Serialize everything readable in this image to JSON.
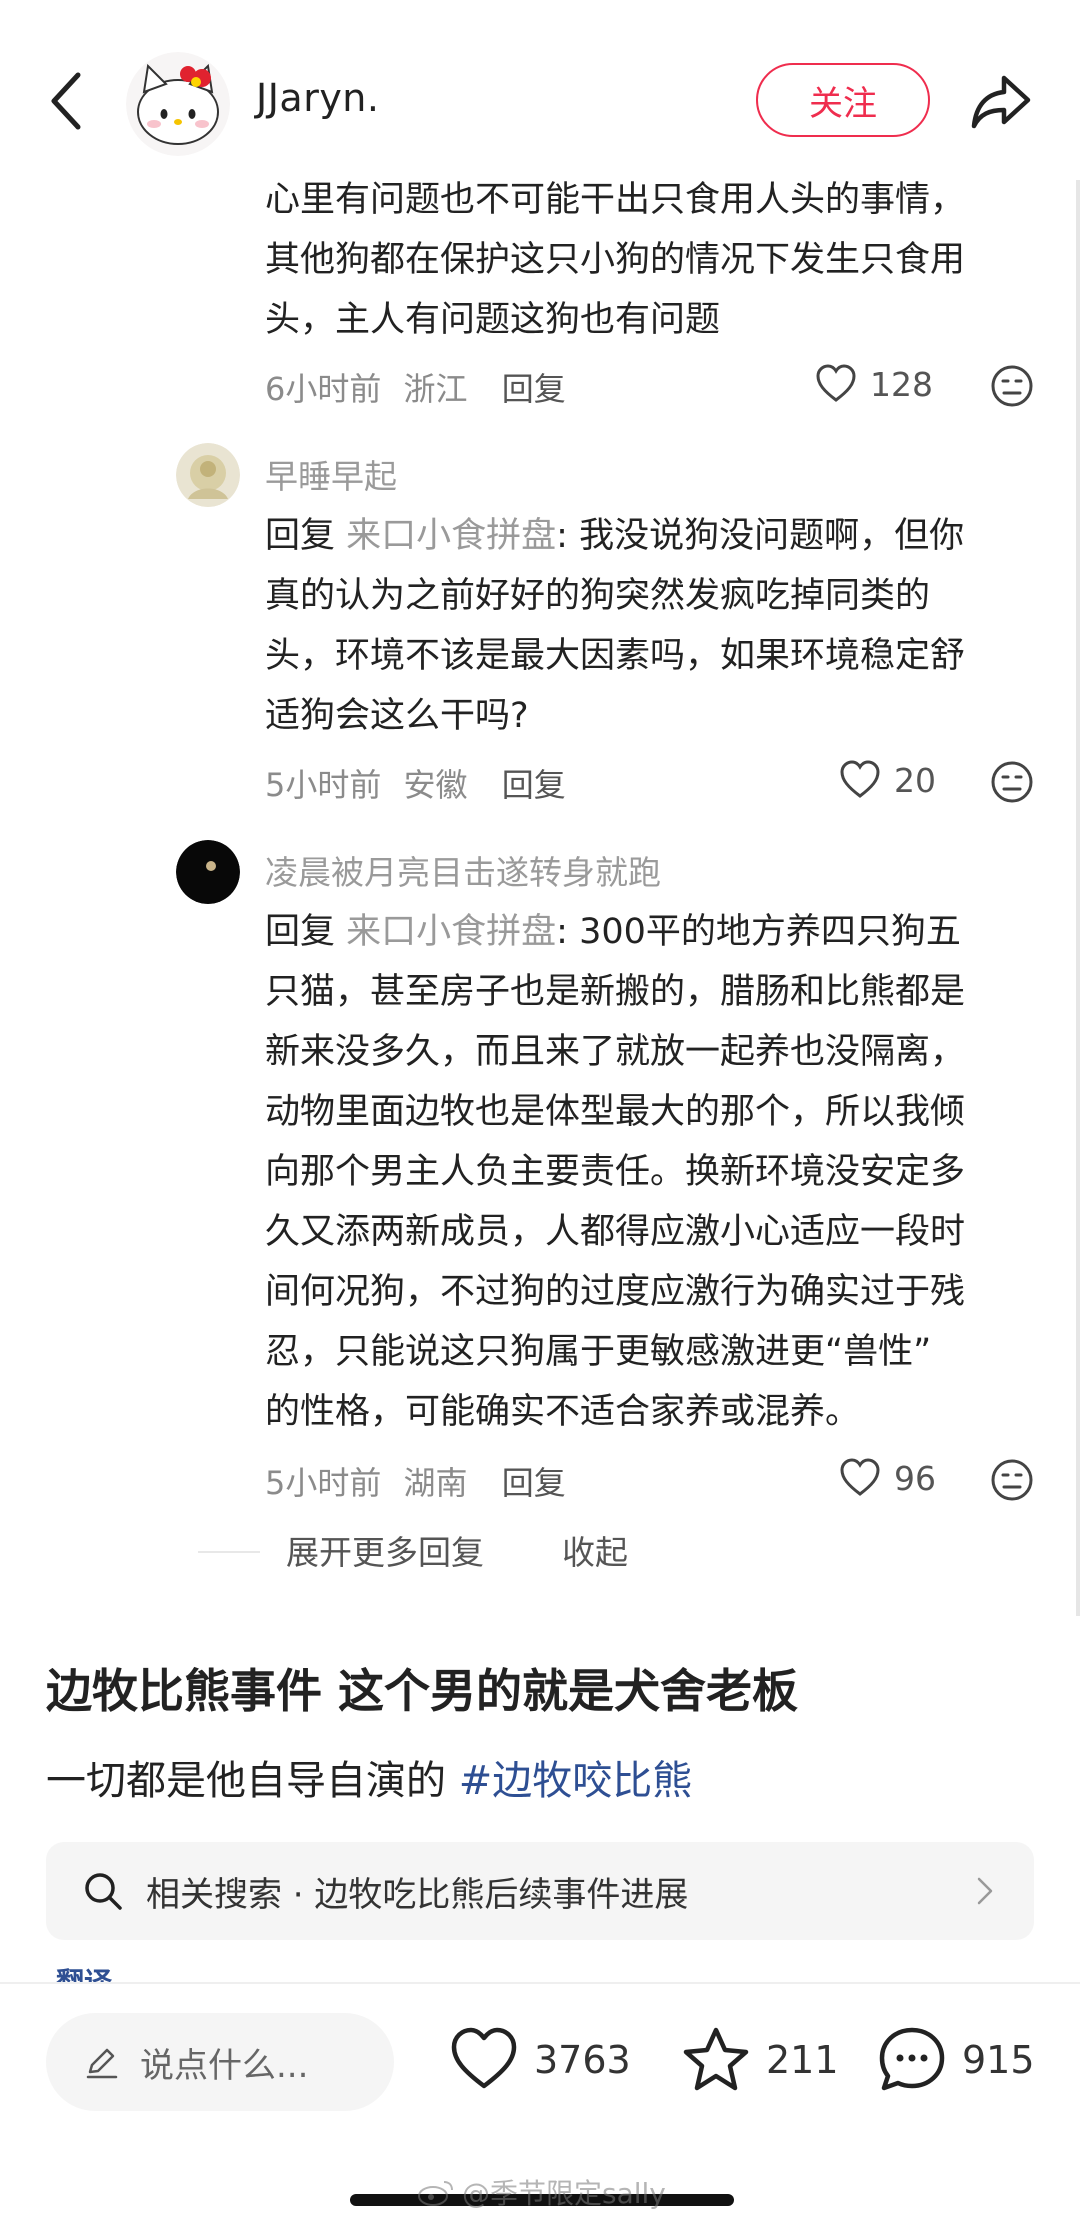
{
  "header": {
    "author_name": "JJaryn.",
    "follow_label": "关注"
  },
  "comments": [
    {
      "lines": [
        "心里有问题也不可能干出只食用人头的事情，",
        "其他狗都在保护这只小狗的情况下发生只食用",
        "头，主人有问题这狗也有问题"
      ],
      "time": "6小时前",
      "location": "浙江",
      "reply_label": "回复",
      "likes": "128"
    },
    {
      "user": "早睡早起",
      "reply_prefix": "回复",
      "reply_to": "来口小食拼盘",
      "lines": [
        ": 我没说狗没问题啊，但你",
        "真的认为之前好好的狗突然发疯吃掉同类的",
        "头，环境不该是最大因素吗，如果环境稳定舒",
        "适狗会这么干吗?"
      ],
      "time": "5小时前",
      "location": "安徽",
      "reply_label": "回复",
      "likes": "20"
    },
    {
      "user": "凌晨被月亮目击遂转身就跑",
      "reply_prefix": "回复",
      "reply_to": "来口小食拼盘",
      "lines": [
        ": 300平的地方养四只狗五",
        "只猫，甚至房子也是新搬的，腊肠和比熊都是",
        "新来没多久，而且来了就放一起养也没隔离，",
        "动物里面边牧也是体型最大的那个，所以我倾",
        "向那个男主人负主要责任。换新环境没安定多",
        "久又添两新成员，人都得应激小心适应一段时",
        "间何况狗，不过狗的过度应激行为确实过于残",
        "忍，只能说这只狗属于更敏感激进更“兽性”",
        "的性格，可能确实不适合家养或混养。"
      ],
      "time": "5小时前",
      "location": "湖南",
      "reply_label": "回复",
      "likes": "96"
    }
  ],
  "expand": {
    "more_label": "展开更多回复",
    "collapse_label": "收起"
  },
  "post": {
    "title": "边牧比熊事件 这个男的就是犬舍老板",
    "body": "一切都是他自导自演的 ",
    "hashtag": "#边牧咬比熊"
  },
  "related_search": {
    "label": "相关搜索 · 边牧吃比熊后续事件进展"
  },
  "translate_label": "翻译",
  "bottom_bar": {
    "input_placeholder": "说点什么...",
    "likes": "3763",
    "stars": "211",
    "comments": "915"
  },
  "watermark": "@季节限定sally",
  "colors": {
    "accent": "#ef2d4e",
    "hashtag": "#2e4f93",
    "muted_text": "#9a9a9a"
  }
}
